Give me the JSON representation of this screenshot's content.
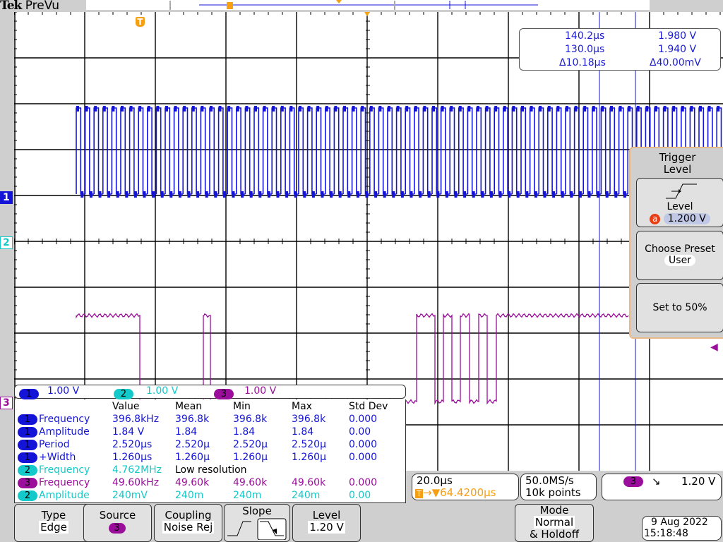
{
  "brand": {
    "name": "Tek",
    "mode": "PreVu"
  },
  "colors": {
    "ch1": "#1414d8",
    "ch2": "#13c9c9",
    "ch3": "#9b0d9b",
    "trigger": "#f5a014",
    "grid": "#000000"
  },
  "cursor_readout": {
    "t1": "140.2µs",
    "v1": "1.980 V",
    "t2": "130.0µs",
    "v2": "1.940 V",
    "dt": "Δ10.18µs",
    "dv": "Δ40.00mV"
  },
  "side_menu": {
    "title_line1": "Trigger",
    "title_line2": "Level",
    "level_label": "Level",
    "level_badge": "a",
    "level_value": "1.200 V",
    "preset_label": "Choose Preset",
    "preset_value": "User",
    "set50_label": "Set to 50%"
  },
  "channel_markers": {
    "ch1": "1",
    "ch2": "2",
    "ch3": "3"
  },
  "scale_bar": [
    {
      "ch": "1",
      "scale": "1.00 V"
    },
    {
      "ch": "2",
      "scale": "1.00 V"
    },
    {
      "ch": "3",
      "scale": "1.00 V"
    }
  ],
  "measurements": {
    "headers": [
      "Value",
      "Mean",
      "Min",
      "Max",
      "Std Dev"
    ],
    "rows": [
      {
        "ch": "1",
        "name": "Frequency",
        "value": "396.8kHz",
        "mean": "396.8k",
        "min": "396.8k",
        "max": "396.8k",
        "std": "0.000"
      },
      {
        "ch": "1",
        "name": "Amplitude",
        "value": "1.84 V",
        "mean": "1.84",
        "min": "1.84",
        "max": "1.84",
        "std": "0.00"
      },
      {
        "ch": "1",
        "name": "Period",
        "value": "2.520µs",
        "mean": "2.520µ",
        "min": "2.520µ",
        "max": "2.520µ",
        "std": "0.000"
      },
      {
        "ch": "1",
        "name": "+Width",
        "value": "1.260µs",
        "mean": "1.260µ",
        "min": "1.260µ",
        "max": "1.260µ",
        "std": "0.000"
      },
      {
        "ch": "2",
        "name": "Frequency",
        "value": "4.762MHz",
        "mean": "Low resolution",
        "min": "",
        "max": "",
        "std": ""
      },
      {
        "ch": "3",
        "name": "Frequency",
        "value": "49.60kHz",
        "mean": "49.60k",
        "min": "49.60k",
        "max": "49.60k",
        "std": "0.000"
      },
      {
        "ch": "2",
        "name": "Amplitude",
        "value": "240mV",
        "mean": "240m",
        "min": "240m",
        "max": "240m",
        "std": "0.00"
      }
    ]
  },
  "horizontal": {
    "scale": "20.0µs",
    "delay": "64.4200µs",
    "sample_rate": "50.0MS/s",
    "record": "10k points"
  },
  "trigger_status": {
    "source": "3",
    "slope_glyph": "↘",
    "level": "1.20 V"
  },
  "bottom_menu": {
    "type_label": "Type",
    "type_value": "Edge",
    "source_label": "Source",
    "source_value": "3",
    "coupling_label": "Coupling",
    "coupling_value": "Noise Rej",
    "slope_label": "Slope",
    "level_label": "Level",
    "level_value": "1.20 V",
    "mode_label": "Mode",
    "mode_value": "Normal",
    "mode_value2": "& Holdoff"
  },
  "datetime": {
    "date": "9 Aug 2022",
    "time": "15:18:48"
  }
}
